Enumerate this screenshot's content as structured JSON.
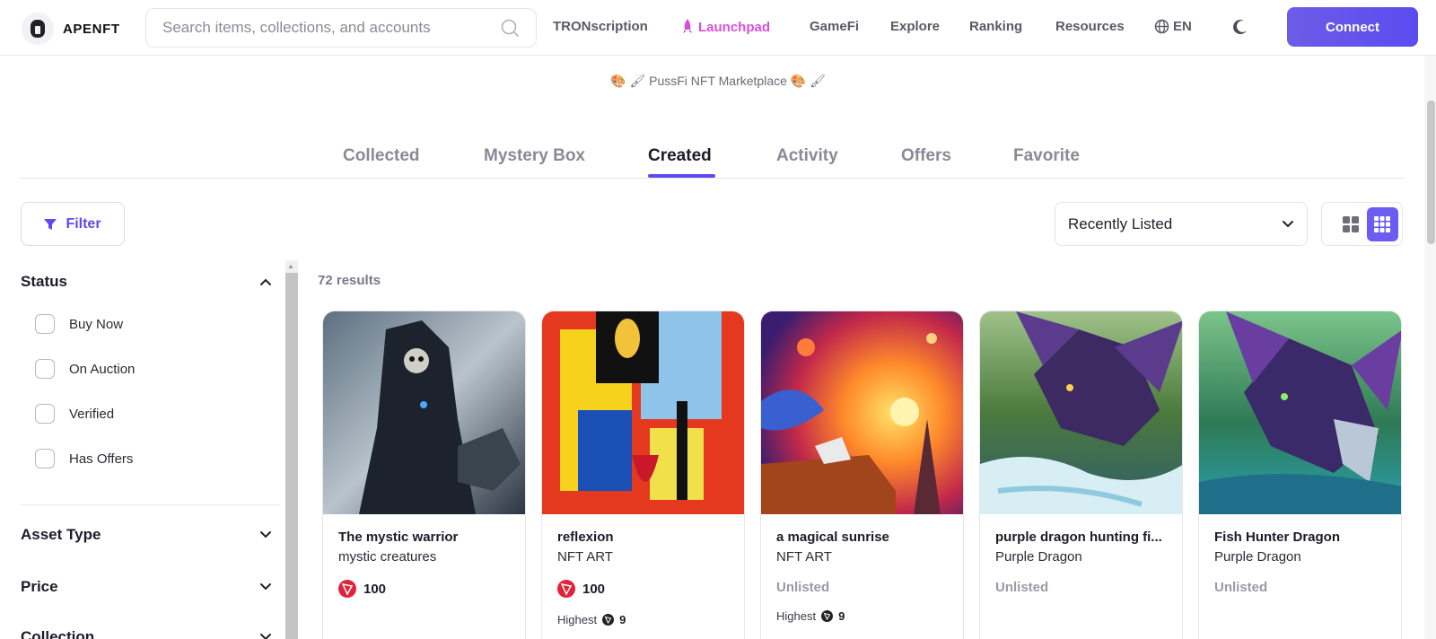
{
  "header": {
    "logo_text": "APENFT",
    "search_placeholder": "Search items, collections, and accounts",
    "nav": {
      "tronscription": "TRONscription",
      "launchpad": "Launchpad",
      "gamefi": "GameFi",
      "explore": "Explore",
      "ranking": "Ranking",
      "resources": "Resources",
      "language": "EN"
    },
    "connect_label": "Connect",
    "accent_color": "#5b4cf0",
    "launchpad_color": "#d94fd8"
  },
  "profile": {
    "banner_text": "🎨 🖌 PussFi NFT Marketplace 🎨 🖌"
  },
  "tabs": [
    {
      "label": "Collected",
      "active": false
    },
    {
      "label": "Mystery Box",
      "active": false
    },
    {
      "label": "Created",
      "active": true
    },
    {
      "label": "Activity",
      "active": false
    },
    {
      "label": "Offers",
      "active": false
    },
    {
      "label": "Favorite",
      "active": false
    }
  ],
  "toolbar": {
    "filter_label": "Filter",
    "sort_value": "Recently Listed",
    "view_mode": "large-grid"
  },
  "sidebar": {
    "status_title": "Status",
    "status_options": [
      "Buy Now",
      "On Auction",
      "Verified",
      "Has Offers"
    ],
    "asset_type_title": "Asset Type",
    "price_title": "Price",
    "collection_title": "Collection"
  },
  "results": {
    "count_label": "72 results"
  },
  "cards": [
    {
      "title": "The mystic warrior",
      "collection": "mystic creatures",
      "price": "100",
      "status": "",
      "highest_label": "",
      "highest_value": "",
      "currency_icon": "tron-icon"
    },
    {
      "title": "reflexion",
      "collection": "NFT ART",
      "price": "100",
      "status": "",
      "highest_label": "Highest",
      "highest_value": "9",
      "currency_icon": "tron-icon"
    },
    {
      "title": "a magical sunrise",
      "collection": "NFT ART",
      "price": "",
      "status": "Unlisted",
      "highest_label": "Highest",
      "highest_value": "9",
      "currency_icon": ""
    },
    {
      "title": "purple dragon hunting fi...",
      "collection": "Purple Dragon",
      "price": "",
      "status": "Unlisted",
      "highest_label": "",
      "highest_value": "",
      "currency_icon": ""
    },
    {
      "title": "Fish Hunter Dragon",
      "collection": "Purple Dragon",
      "price": "",
      "status": "Unlisted",
      "highest_label": "",
      "highest_value": "",
      "currency_icon": ""
    }
  ]
}
